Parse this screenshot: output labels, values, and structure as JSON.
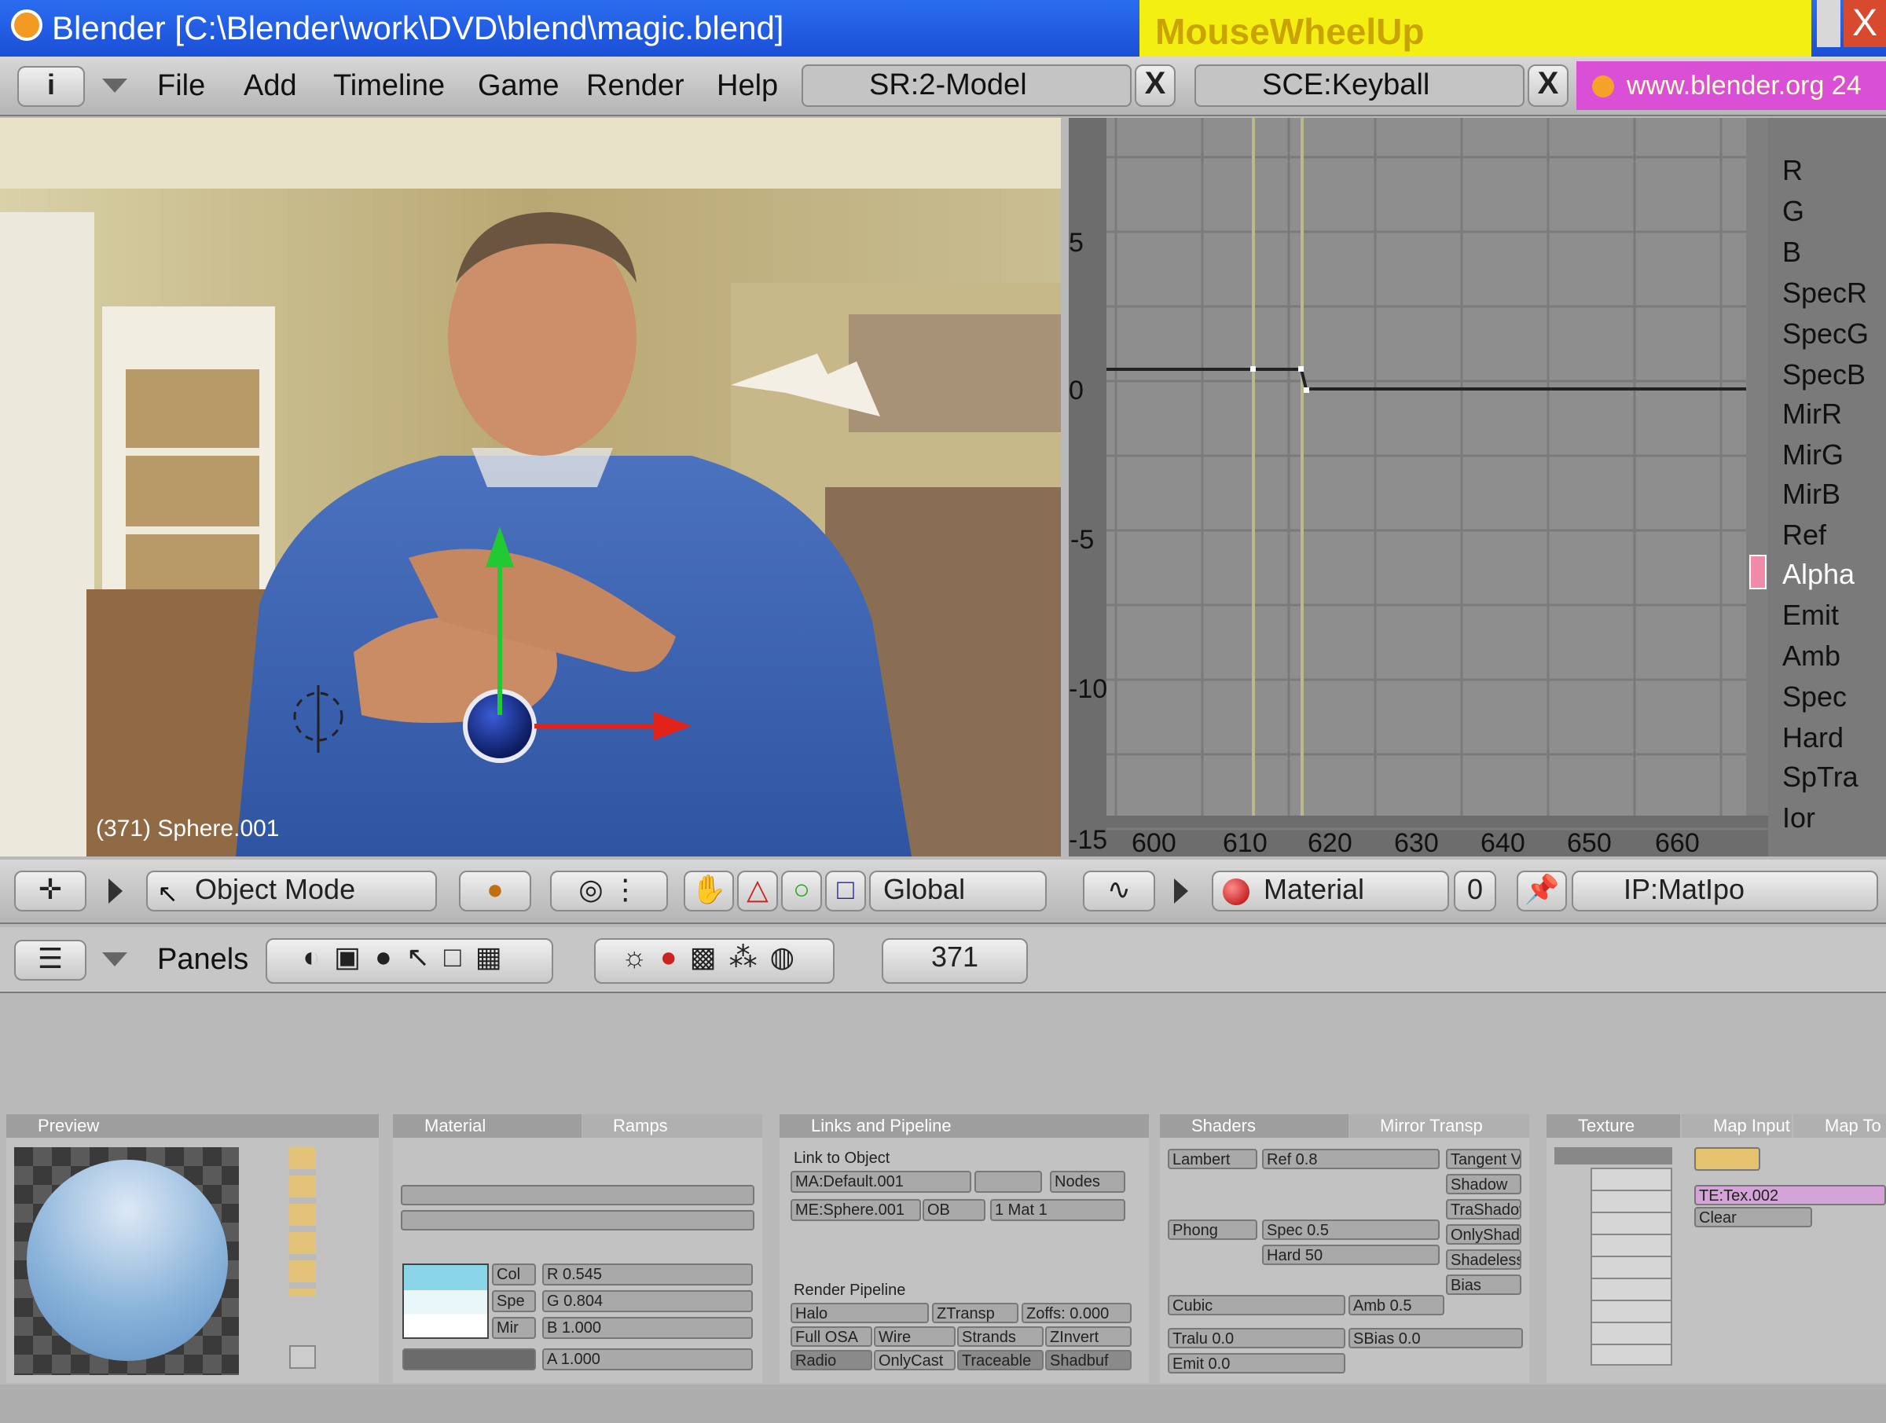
{
  "window": {
    "title": "Blender [C:\\Blender\\work\\DVD\\blend\\magic.blend]",
    "key_overlay": "MouseWheelUp",
    "close": "X"
  },
  "menubar": {
    "info_btn": "i",
    "menus": [
      "File",
      "Add",
      "Timeline",
      "Game",
      "Render",
      "Help"
    ],
    "screen_field": "SR:2-Model",
    "scene_field": "SCE:Keyball",
    "close": "X",
    "web": "www.blender.org 24"
  },
  "viewport": {
    "object_label": "(371) Sphere.001",
    "header": {
      "mode": "Object Mode",
      "orientation": "Global"
    }
  },
  "ipo": {
    "y_ticks": [
      "5",
      "0",
      "-5",
      "-10",
      "-15"
    ],
    "x_ticks": [
      "600",
      "610",
      "620",
      "630",
      "640",
      "650",
      "660"
    ],
    "channels": [
      "R",
      "G",
      "B",
      "SpecR",
      "SpecG",
      "SpecB",
      "MirR",
      "MirG",
      "MirB",
      "Ref",
      "Alpha",
      "Emit",
      "Amb",
      "Spec",
      "Hard",
      "SpTra",
      "Ior"
    ],
    "selected_channel": "Alpha",
    "header": {
      "view": "Material",
      "index": "0",
      "ipo_name": "IP:MatIpo"
    }
  },
  "buttons": {
    "panels_label": "Panels",
    "frame": "371",
    "panels": [
      "Preview",
      "Material",
      "Ramps",
      "Links and Pipeline",
      "Shaders",
      "Mirror Transp",
      "Texture",
      "Map Input",
      "Map To"
    ],
    "material": {
      "swatch_labels": [
        "Col",
        "Spe",
        "Mir"
      ],
      "values": [
        "R 0.545",
        "G 0.804",
        "B 1.000",
        "A 1.000"
      ]
    },
    "links": {
      "link_to_object": "Link to Object",
      "ma": "MA:Default.001",
      "nodes": "Nodes",
      "me": "ME:Sphere.001",
      "ob": "OB",
      "mat": "1 Mat 1",
      "render_pipeline": "Render Pipeline",
      "halo": "Halo",
      "ztransp": "ZTransp",
      "zoffs": "Zoffs: 0.000",
      "full_osa": "Full OSA",
      "wire": "Wire",
      "strands": "Strands",
      "zinvert": "ZInvert",
      "radio": "Radio",
      "onlycast": "OnlyCast",
      "traceable": "Traceable",
      "shadbuf": "Shadbuf"
    },
    "shaders": {
      "lambert": "Lambert",
      "ref": "Ref 0.8",
      "tangent": "Tangent V",
      "phong": "Phong",
      "spec": "Spec 0.5",
      "hard": "Hard 50",
      "cubic": "Cubic",
      "bias": "Bias",
      "tralu": "Tralu 0.0",
      "sbias": "SBias 0.0",
      "amb": "Amb 0.5",
      "emit": "Emit 0.0",
      "shadow": "Shadow",
      "traShadow": "TraShadow",
      "only_shadow": "OnlyShad",
      "shadeless": "Shadeless"
    },
    "texture": {
      "tex": "TE:Tex.002",
      "clear": "Clear"
    }
  }
}
